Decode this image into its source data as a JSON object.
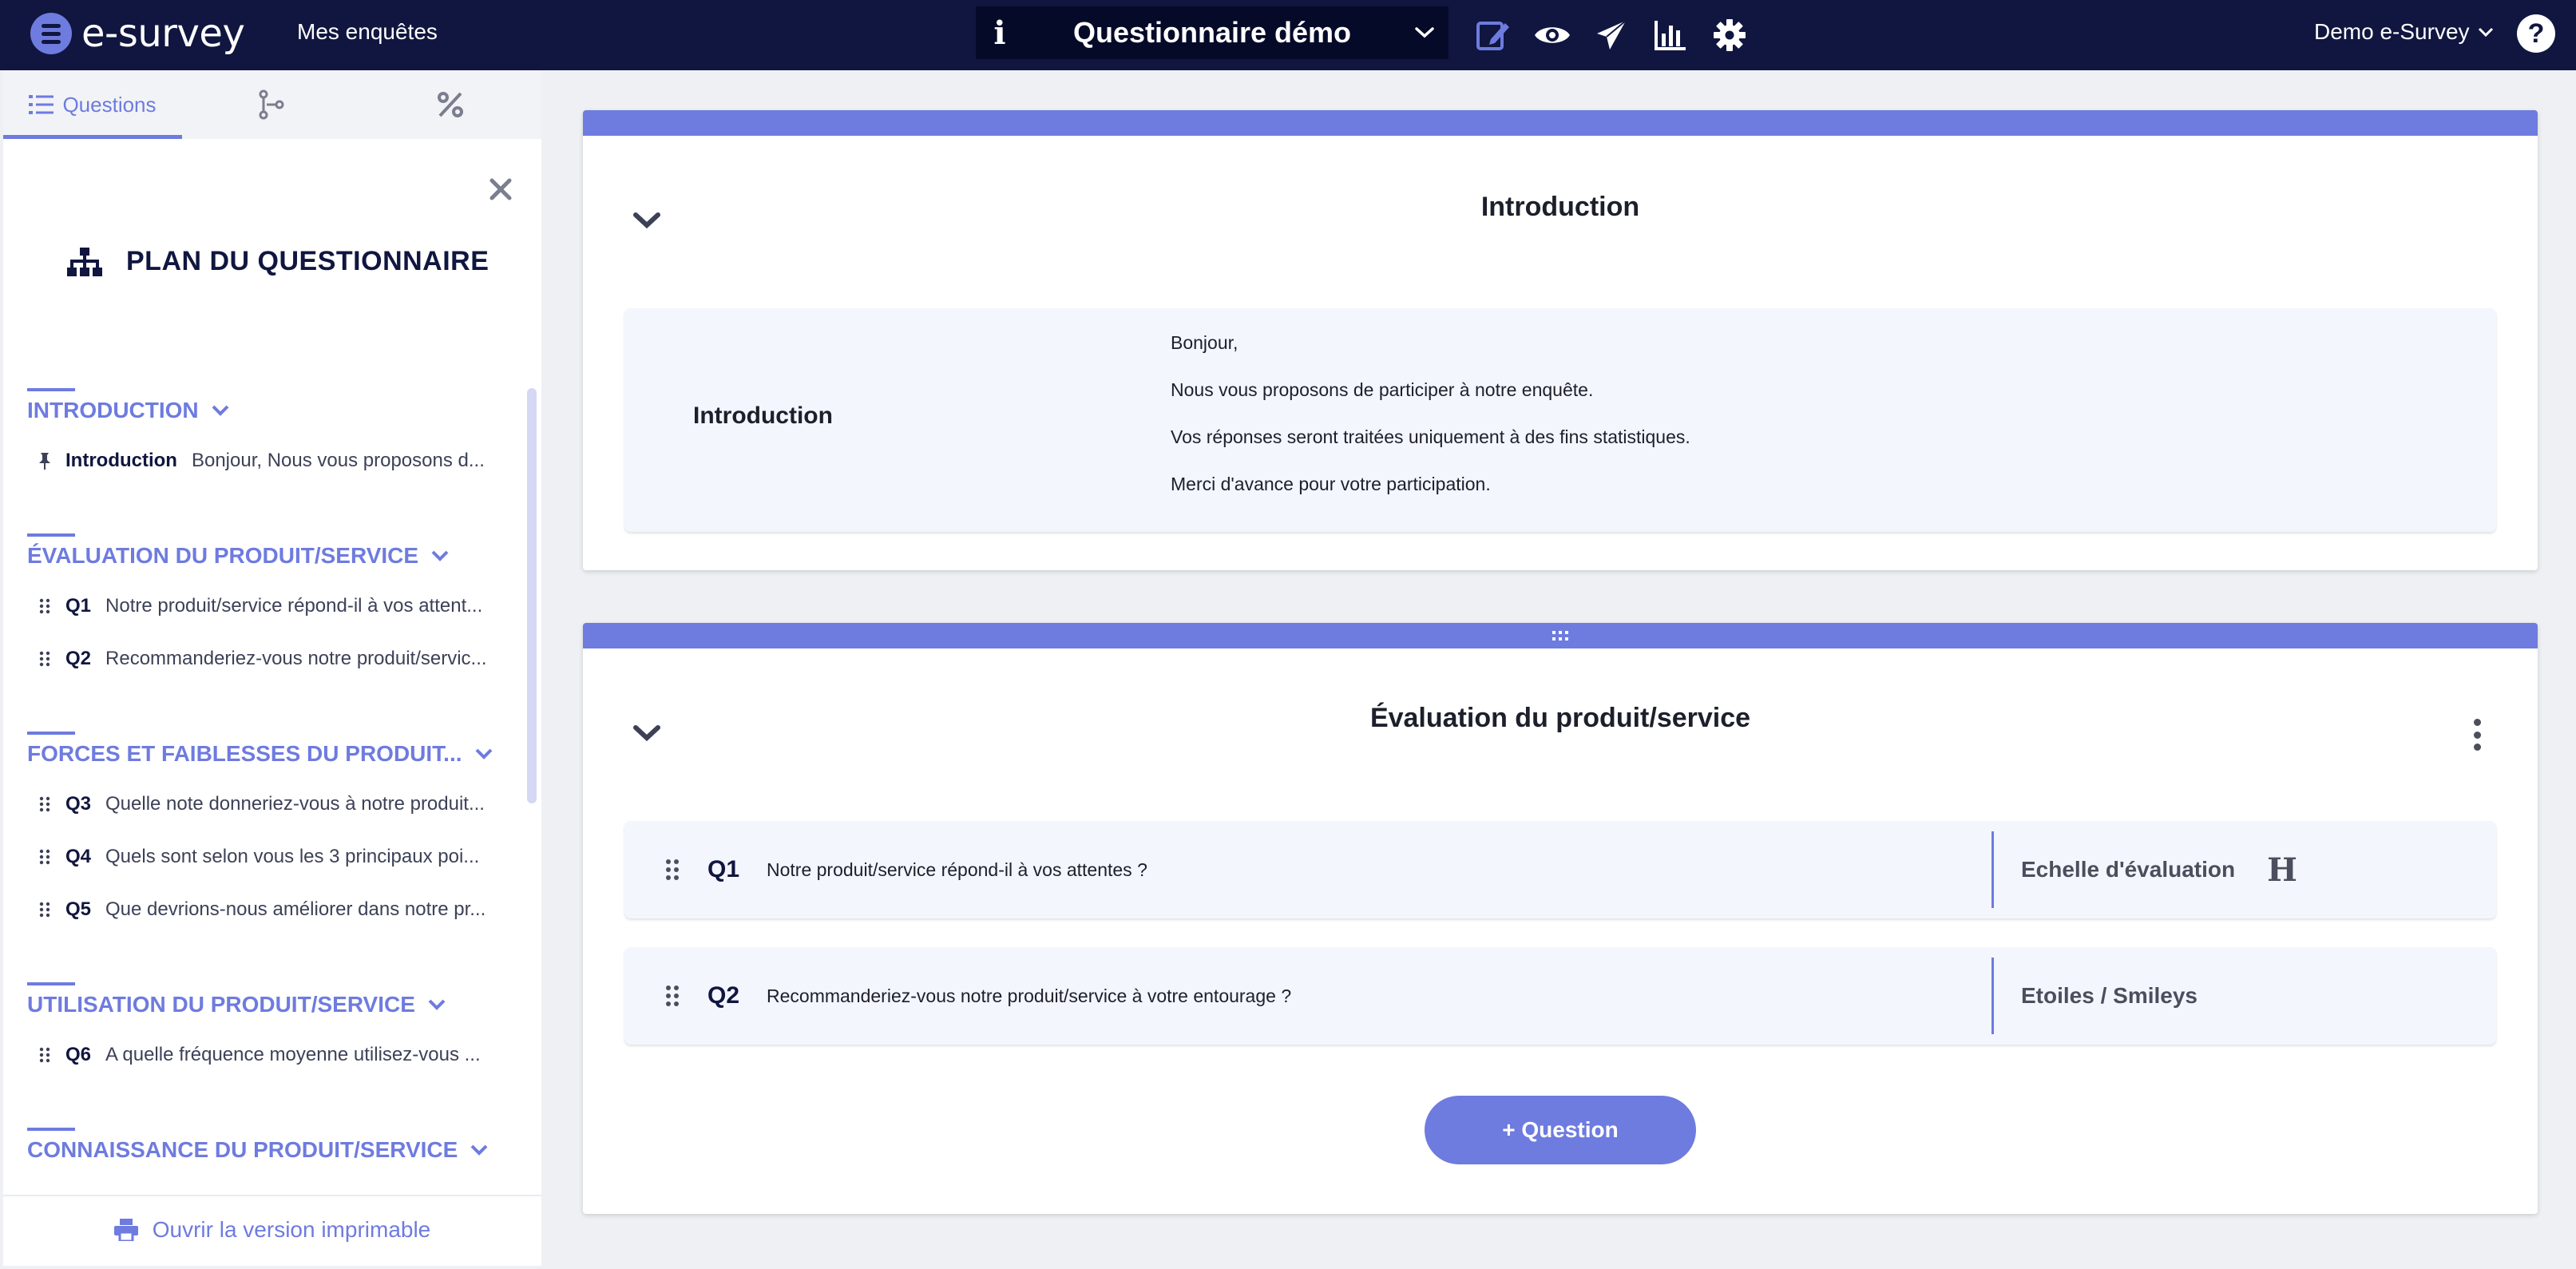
{
  "app": {
    "logo_text": "e-survey",
    "nav_link": "Mes enquêtes",
    "survey_title": "Questionnaire démo",
    "user_name": "Demo e-Survey",
    "help_glyph": "?"
  },
  "toolbar_icons": [
    "edit-icon",
    "eye-icon",
    "send-icon",
    "bar-chart-icon",
    "gear-icon"
  ],
  "sidebar": {
    "tabs": [
      {
        "label": "Questions",
        "icon": "list-icon",
        "active": true
      },
      {
        "label": "",
        "icon": "branching-icon",
        "active": false
      },
      {
        "label": "",
        "icon": "percent-icon",
        "active": false
      }
    ],
    "plan_title": "PLAN DU QUESTIONNAIRE",
    "sections": [
      {
        "title": "INTRODUCTION",
        "items": [
          {
            "code": "Introduction",
            "text": "Bonjour, Nous vous proposons d...",
            "icon": "pin-icon"
          }
        ]
      },
      {
        "title": "ÉVALUATION DU PRODUIT/SERVICE",
        "items": [
          {
            "code": "Q1",
            "text": "Notre produit/service répond-il à vos attent..."
          },
          {
            "code": "Q2",
            "text": "Recommanderiez-vous notre produit/servic..."
          }
        ]
      },
      {
        "title": "FORCES ET FAIBLESSES DU PRODUIT...",
        "items": [
          {
            "code": "Q3",
            "text": "Quelle note donneriez-vous à notre produit..."
          },
          {
            "code": "Q4",
            "text": "Quels sont selon vous les 3 principaux poi..."
          },
          {
            "code": "Q5",
            "text": "Que devrions-nous améliorer dans notre pr..."
          }
        ]
      },
      {
        "title": "UTILISATION DU PRODUIT/SERVICE",
        "items": [
          {
            "code": "Q6",
            "text": "A quelle fréquence moyenne utilisez-vous ..."
          }
        ]
      },
      {
        "title": "CONNAISSANCE DU PRODUIT/SERVICE",
        "items": []
      }
    ],
    "print_link": "Ouvrir la version imprimable"
  },
  "main": {
    "intro_page": {
      "title": "Introduction",
      "block_label": "Introduction",
      "lines": [
        "Bonjour,",
        "Nous vous proposons de participer à notre enquête.",
        "Vos réponses seront traitées uniquement à des fins statistiques.",
        "Merci d'avance pour votre participation."
      ]
    },
    "eval_page": {
      "title": "Évaluation du produit/service",
      "questions": [
        {
          "code": "Q1",
          "text": "Notre produit/service répond-il à vos attentes ?",
          "type": "Echelle d'évaluation",
          "type_glyph": "H"
        },
        {
          "code": "Q2",
          "text": "Recommanderiez-vous notre produit/service à votre entourage ?",
          "type": "Etoiles / Smileys",
          "type_glyph": ""
        }
      ],
      "add_button": "+ Question"
    }
  },
  "colors": {
    "topbar": "#10163f",
    "accent": "#6e7bdf",
    "block_bg": "#f3f6fd",
    "page_bg": "#eef0f3"
  }
}
